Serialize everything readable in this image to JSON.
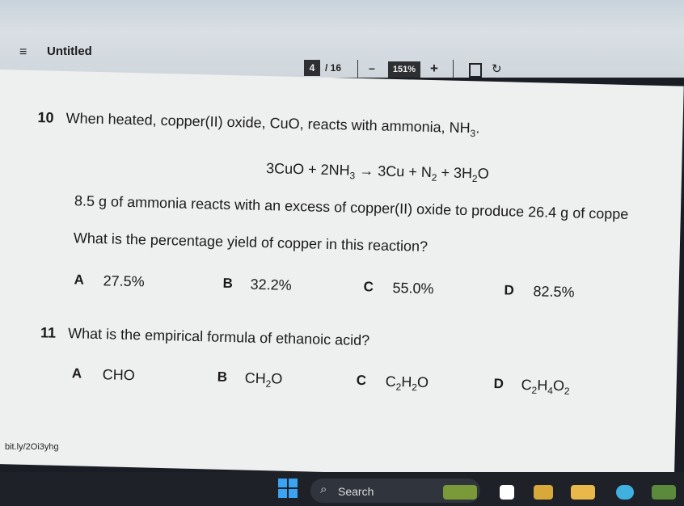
{
  "toolbar": {
    "title": "Untitled",
    "page_current": "4",
    "page_total": "/ 16",
    "zoom_out": "–",
    "zoom": "151%",
    "zoom_in": "+"
  },
  "q10": {
    "number": "10",
    "stem": "When heated, copper(II) oxide, CuO, reacts with ammonia, NH",
    "stem_sub": "3",
    "stem_end": ".",
    "equation": {
      "a": "3CuO  +  2NH",
      "a_sub": "3",
      "arrow": " → ",
      "b": "3Cu  +  N",
      "b_sub": "2",
      "c": "  +  3H",
      "c_sub": "2",
      "d": "O"
    },
    "line2": "8.5 g of ammonia reacts with an excess of copper(II) oxide to produce 26.4 g of coppe",
    "line3": "What is the percentage yield of copper in this reaction?",
    "options": [
      {
        "letter": "A",
        "text": "27.5%"
      },
      {
        "letter": "B",
        "text": "32.2%"
      },
      {
        "letter": "C",
        "text": "55.0%"
      },
      {
        "letter": "D",
        "text": "82.5%"
      }
    ]
  },
  "q11": {
    "number": "11",
    "stem": "What is the empirical formula of ethanoic acid?",
    "options": {
      "A": {
        "letter": "A",
        "text": "CHO"
      },
      "B": {
        "letter": "B",
        "p1": "CH",
        "s1": "2",
        "p2": "O"
      },
      "C": {
        "letter": "C",
        "p1": "C",
        "s1": "2",
        "p2": "H",
        "s2": "2",
        "p3": "O"
      },
      "D": {
        "letter": "D",
        "p1": "C",
        "s1": "2",
        "p2": "H",
        "s2": "4",
        "p3": "O",
        "s3": "2"
      }
    }
  },
  "watermark": "bit.ly/2Oi3yhg",
  "taskbar": {
    "search": "Search"
  }
}
